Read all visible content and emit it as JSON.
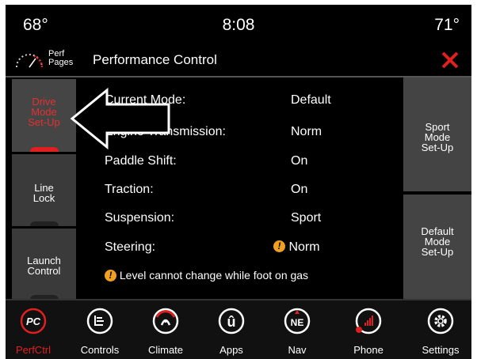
{
  "status": {
    "temp_left": "68°",
    "clock": "8:08",
    "temp_right": "71°"
  },
  "header": {
    "perf_pages": "Perf\nPages",
    "title": "Performance Control"
  },
  "side_left": [
    {
      "label": "Drive\nMode\nSet-Up",
      "active": true
    },
    {
      "label": "Line\nLock",
      "active": false
    },
    {
      "label": "Launch\nControl",
      "active": false
    }
  ],
  "side_right": [
    {
      "label": "Sport\nMode\nSet-Up"
    },
    {
      "label": "Default\nMode\nSet-Up"
    }
  ],
  "settings": [
    {
      "label": "Current Mode:",
      "value": "Default"
    },
    {
      "label": "Engine Transmission:",
      "value": "Norm"
    },
    {
      "label": "Paddle Shift:",
      "value": "On"
    },
    {
      "label": "Traction:",
      "value": "On"
    },
    {
      "label": "Suspension:",
      "value": "Sport"
    },
    {
      "label": "Steering:",
      "value": "Norm",
      "warning": true
    }
  ],
  "warning_text": "Level cannot change while foot on gas",
  "warning_glyph": "!",
  "nav": [
    {
      "label": "PerfCtrl",
      "icon": "pc-icon",
      "active": true
    },
    {
      "label": "Controls",
      "icon": "controls-icon"
    },
    {
      "label": "Climate",
      "icon": "climate-icon"
    },
    {
      "label": "Apps",
      "icon": "apps-icon"
    },
    {
      "label": "Nav",
      "icon": "compass-icon"
    },
    {
      "label": "Phone",
      "icon": "phone-icon"
    },
    {
      "label": "Settings",
      "icon": "gear-icon"
    }
  ],
  "nav_icon_text": {
    "pc": "PC",
    "compass": "NE",
    "apps": "û"
  },
  "colors": {
    "accent_red": "#e02020",
    "warning": "#f0a020",
    "background": "#000000"
  }
}
